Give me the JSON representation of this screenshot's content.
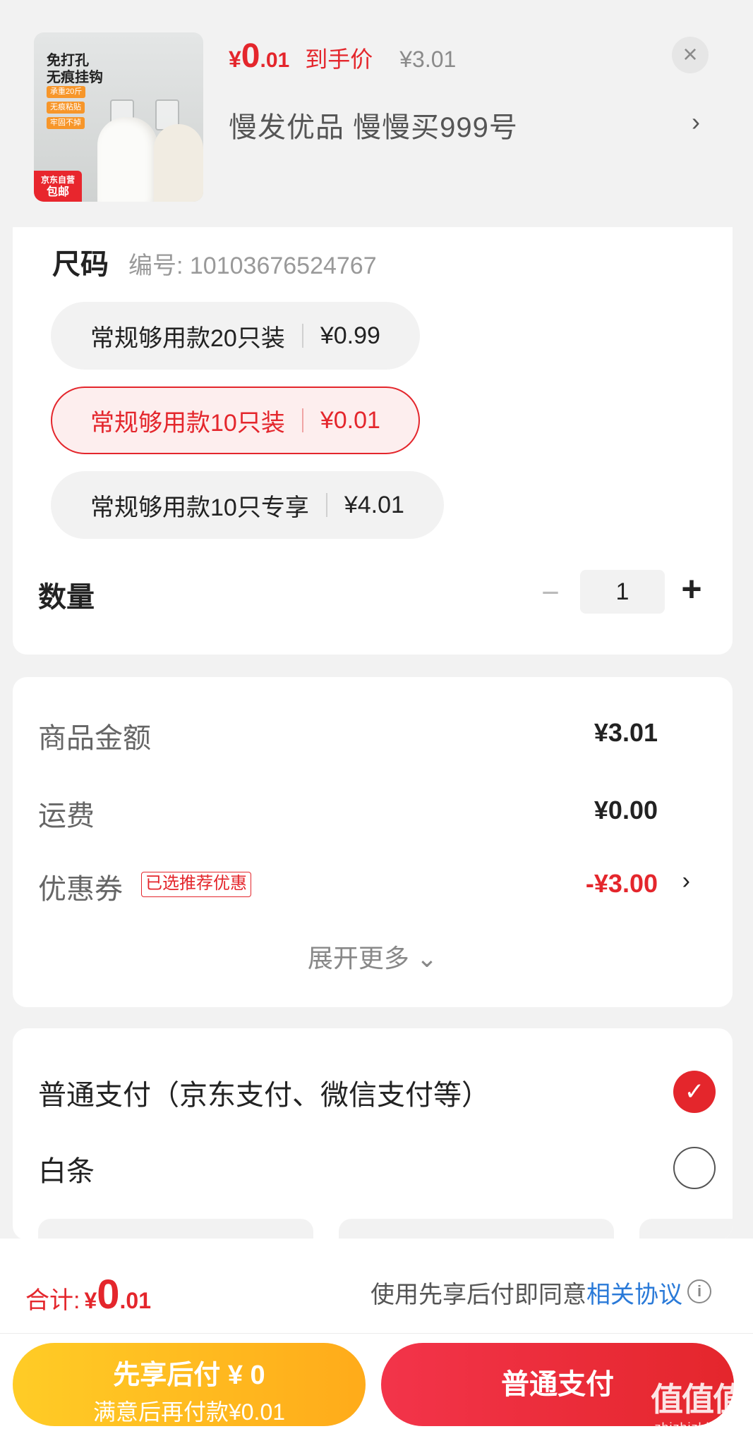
{
  "product": {
    "image_text": {
      "title": "免打孔\n无痕挂钩",
      "chips": [
        "承重20斤",
        "无痕粘贴",
        "牢固不掉"
      ],
      "badge_line1": "京东自营",
      "badge_line2": "包邮"
    },
    "price_symbol": "¥",
    "price_int": "0",
    "price_dec": ".01",
    "price_tag": "到手价",
    "original_price": "¥3.01",
    "sku_title": "慢发优品 慢慢买999号",
    "sku_arrow": "›",
    "close_label": "×"
  },
  "spec": {
    "label": "尺码",
    "code": "编号: 10103676524767",
    "options": [
      {
        "name": "常规够用款20只装",
        "price": "¥0.99",
        "selected": false
      },
      {
        "name": "常规够用款10只装",
        "price": "¥0.01",
        "selected": true
      },
      {
        "name": "常规够用款10只专享",
        "price": "¥4.01",
        "selected": false
      }
    ]
  },
  "quantity": {
    "label": "数量",
    "minus": "−",
    "value": "1",
    "plus": "+"
  },
  "amounts": {
    "goods_label": "商品金额",
    "goods_value": "¥3.01",
    "shipping_label": "运费",
    "shipping_value": "¥0.00",
    "coupon_label": "优惠券",
    "coupon_tag": "已选推荐优惠",
    "coupon_value": "-¥3.00",
    "coupon_arrow": "›",
    "expand_label": "展开更多 ⌄"
  },
  "payment": {
    "normal_label": "普通支付（京东支付、微信支付等）",
    "normal_checked": true,
    "check_glyph": "✓",
    "baitiao_label": "白条",
    "baitiao_checked": false
  },
  "footer": {
    "total_label": "合计:",
    "total_symbol": "¥",
    "total_int": "0",
    "total_dec": ".01",
    "agree_text": "使用先享后付即同意",
    "agree_link": "相关协议",
    "info_glyph": "i",
    "later_line1": "先享后付 ¥ 0",
    "later_line2": "满意后再付款¥0.01",
    "normal_button": "普通支付"
  },
  "watermark": {
    "logo": "值值值",
    "domain": "zhizhizhi.com"
  },
  "colors": {
    "accent": "#e4262c",
    "later_button": "#ffbb20",
    "link": "#2a7ad8"
  }
}
